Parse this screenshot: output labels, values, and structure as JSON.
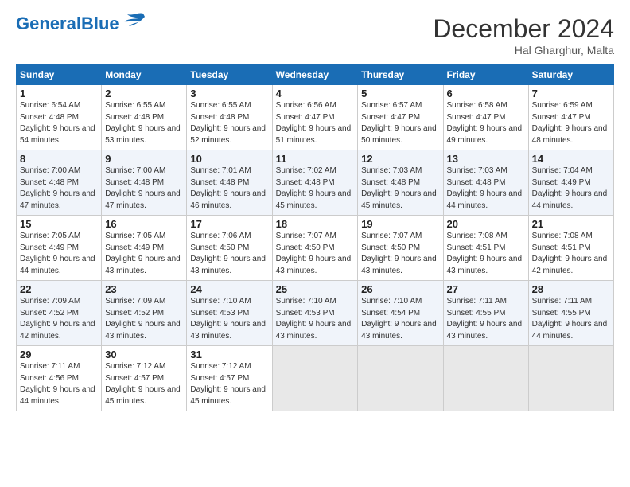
{
  "header": {
    "logo_line1": "General",
    "logo_line2": "Blue",
    "title": "December 2024",
    "subtitle": "Hal Gharghur, Malta"
  },
  "calendar": {
    "days_of_week": [
      "Sunday",
      "Monday",
      "Tuesday",
      "Wednesday",
      "Thursday",
      "Friday",
      "Saturday"
    ],
    "weeks": [
      [
        {
          "day": "1",
          "sunrise": "6:54 AM",
          "sunset": "4:48 PM",
          "daylight": "9 hours and 54 minutes."
        },
        {
          "day": "2",
          "sunrise": "6:55 AM",
          "sunset": "4:48 PM",
          "daylight": "9 hours and 53 minutes."
        },
        {
          "day": "3",
          "sunrise": "6:55 AM",
          "sunset": "4:48 PM",
          "daylight": "9 hours and 52 minutes."
        },
        {
          "day": "4",
          "sunrise": "6:56 AM",
          "sunset": "4:47 PM",
          "daylight": "9 hours and 51 minutes."
        },
        {
          "day": "5",
          "sunrise": "6:57 AM",
          "sunset": "4:47 PM",
          "daylight": "9 hours and 50 minutes."
        },
        {
          "day": "6",
          "sunrise": "6:58 AM",
          "sunset": "4:47 PM",
          "daylight": "9 hours and 49 minutes."
        },
        {
          "day": "7",
          "sunrise": "6:59 AM",
          "sunset": "4:47 PM",
          "daylight": "9 hours and 48 minutes."
        }
      ],
      [
        {
          "day": "8",
          "sunrise": "7:00 AM",
          "sunset": "4:48 PM",
          "daylight": "9 hours and 47 minutes."
        },
        {
          "day": "9",
          "sunrise": "7:00 AM",
          "sunset": "4:48 PM",
          "daylight": "9 hours and 47 minutes."
        },
        {
          "day": "10",
          "sunrise": "7:01 AM",
          "sunset": "4:48 PM",
          "daylight": "9 hours and 46 minutes."
        },
        {
          "day": "11",
          "sunrise": "7:02 AM",
          "sunset": "4:48 PM",
          "daylight": "9 hours and 45 minutes."
        },
        {
          "day": "12",
          "sunrise": "7:03 AM",
          "sunset": "4:48 PM",
          "daylight": "9 hours and 45 minutes."
        },
        {
          "day": "13",
          "sunrise": "7:03 AM",
          "sunset": "4:48 PM",
          "daylight": "9 hours and 44 minutes."
        },
        {
          "day": "14",
          "sunrise": "7:04 AM",
          "sunset": "4:49 PM",
          "daylight": "9 hours and 44 minutes."
        }
      ],
      [
        {
          "day": "15",
          "sunrise": "7:05 AM",
          "sunset": "4:49 PM",
          "daylight": "9 hours and 44 minutes."
        },
        {
          "day": "16",
          "sunrise": "7:05 AM",
          "sunset": "4:49 PM",
          "daylight": "9 hours and 43 minutes."
        },
        {
          "day": "17",
          "sunrise": "7:06 AM",
          "sunset": "4:50 PM",
          "daylight": "9 hours and 43 minutes."
        },
        {
          "day": "18",
          "sunrise": "7:07 AM",
          "sunset": "4:50 PM",
          "daylight": "9 hours and 43 minutes."
        },
        {
          "day": "19",
          "sunrise": "7:07 AM",
          "sunset": "4:50 PM",
          "daylight": "9 hours and 43 minutes."
        },
        {
          "day": "20",
          "sunrise": "7:08 AM",
          "sunset": "4:51 PM",
          "daylight": "9 hours and 43 minutes."
        },
        {
          "day": "21",
          "sunrise": "7:08 AM",
          "sunset": "4:51 PM",
          "daylight": "9 hours and 42 minutes."
        }
      ],
      [
        {
          "day": "22",
          "sunrise": "7:09 AM",
          "sunset": "4:52 PM",
          "daylight": "9 hours and 42 minutes."
        },
        {
          "day": "23",
          "sunrise": "7:09 AM",
          "sunset": "4:52 PM",
          "daylight": "9 hours and 43 minutes."
        },
        {
          "day": "24",
          "sunrise": "7:10 AM",
          "sunset": "4:53 PM",
          "daylight": "9 hours and 43 minutes."
        },
        {
          "day": "25",
          "sunrise": "7:10 AM",
          "sunset": "4:53 PM",
          "daylight": "9 hours and 43 minutes."
        },
        {
          "day": "26",
          "sunrise": "7:10 AM",
          "sunset": "4:54 PM",
          "daylight": "9 hours and 43 minutes."
        },
        {
          "day": "27",
          "sunrise": "7:11 AM",
          "sunset": "4:55 PM",
          "daylight": "9 hours and 43 minutes."
        },
        {
          "day": "28",
          "sunrise": "7:11 AM",
          "sunset": "4:55 PM",
          "daylight": "9 hours and 44 minutes."
        }
      ],
      [
        {
          "day": "29",
          "sunrise": "7:11 AM",
          "sunset": "4:56 PM",
          "daylight": "9 hours and 44 minutes."
        },
        {
          "day": "30",
          "sunrise": "7:12 AM",
          "sunset": "4:57 PM",
          "daylight": "9 hours and 45 minutes."
        },
        {
          "day": "31",
          "sunrise": "7:12 AM",
          "sunset": "4:57 PM",
          "daylight": "9 hours and 45 minutes."
        },
        null,
        null,
        null,
        null
      ]
    ],
    "labels": {
      "sunrise": "Sunrise:",
      "sunset": "Sunset:",
      "daylight": "Daylight:"
    }
  }
}
